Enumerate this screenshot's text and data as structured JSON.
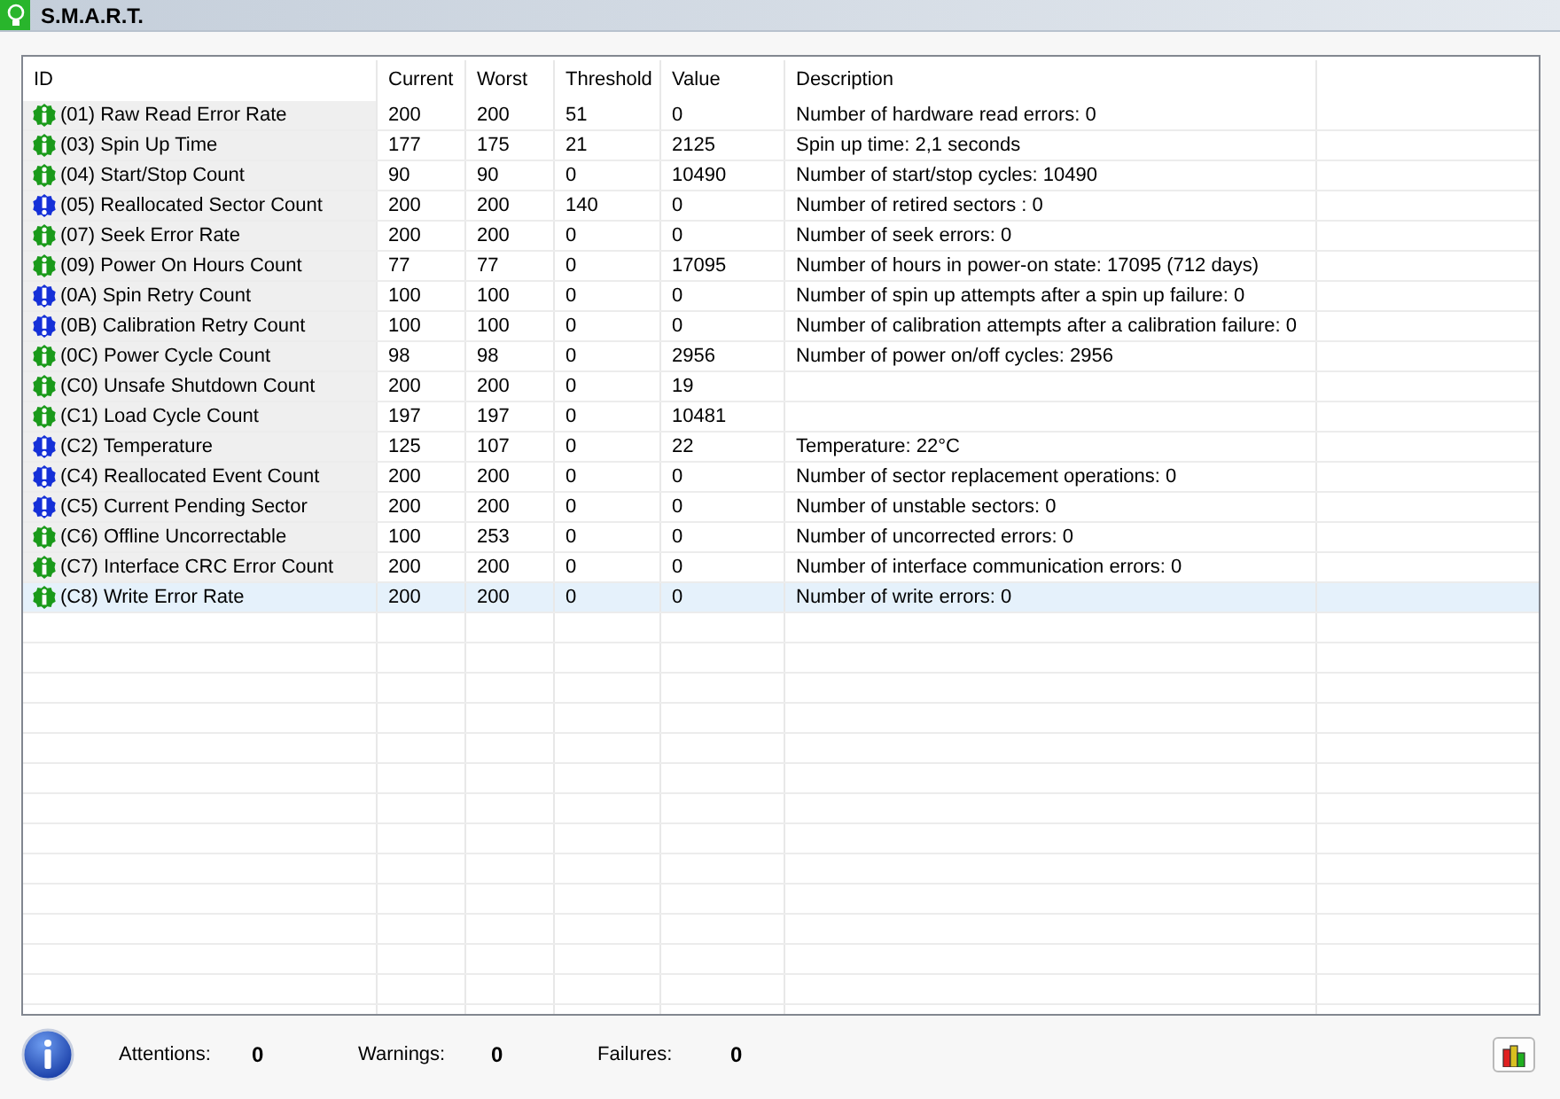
{
  "window": {
    "title": "S.M.A.R.T."
  },
  "table": {
    "columns": [
      "ID",
      "Current",
      "Worst",
      "Threshold",
      "Value",
      "Description"
    ],
    "rows": [
      {
        "kind": "ok",
        "id": "(01) Raw Read Error Rate",
        "current": "200",
        "worst": "200",
        "threshold": "51",
        "value": "0",
        "description": "Number of hardware read errors: 0",
        "selected": false
      },
      {
        "kind": "ok",
        "id": "(03) Spin Up Time",
        "current": "177",
        "worst": "175",
        "threshold": "21",
        "value": "2125",
        "description": "Spin up time: 2,1 seconds",
        "selected": false
      },
      {
        "kind": "ok",
        "id": "(04) Start/Stop Count",
        "current": "90",
        "worst": "90",
        "threshold": "0",
        "value": "10490",
        "description": "Number of start/stop cycles: 10490",
        "selected": false
      },
      {
        "kind": "critical",
        "id": "(05) Reallocated Sector Count",
        "current": "200",
        "worst": "200",
        "threshold": "140",
        "value": "0",
        "description": "Number of retired sectors : 0",
        "selected": false
      },
      {
        "kind": "ok",
        "id": "(07) Seek Error Rate",
        "current": "200",
        "worst": "200",
        "threshold": "0",
        "value": "0",
        "description": "Number of seek errors: 0",
        "selected": false
      },
      {
        "kind": "ok",
        "id": "(09) Power On Hours Count",
        "current": "77",
        "worst": "77",
        "threshold": "0",
        "value": "17095",
        "description": "Number of hours in power-on state: 17095 (712 days)",
        "selected": false
      },
      {
        "kind": "critical",
        "id": "(0A) Spin Retry Count",
        "current": "100",
        "worst": "100",
        "threshold": "0",
        "value": "0",
        "description": "Number of spin up attempts after a spin up failure: 0",
        "selected": false
      },
      {
        "kind": "critical",
        "id": "(0B) Calibration Retry Count",
        "current": "100",
        "worst": "100",
        "threshold": "0",
        "value": "0",
        "description": "Number of calibration attempts after a calibration failure: 0",
        "selected": false
      },
      {
        "kind": "ok",
        "id": "(0C) Power Cycle Count",
        "current": "98",
        "worst": "98",
        "threshold": "0",
        "value": "2956",
        "description": "Number of power on/off cycles: 2956",
        "selected": false
      },
      {
        "kind": "ok",
        "id": "(C0) Unsafe Shutdown Count",
        "current": "200",
        "worst": "200",
        "threshold": "0",
        "value": "19",
        "selected": false
      },
      {
        "kind": "ok",
        "id": "(C1) Load Cycle Count",
        "current": "197",
        "worst": "197",
        "threshold": "0",
        "value": "10481",
        "selected": false
      },
      {
        "kind": "critical",
        "id": "(C2) Temperature",
        "current": "125",
        "worst": "107",
        "threshold": "0",
        "value": "22",
        "description": "Temperature: 22°C",
        "selected": false
      },
      {
        "kind": "critical",
        "id": "(C4) Reallocated Event Count",
        "current": "200",
        "worst": "200",
        "threshold": "0",
        "value": "0",
        "description": "Number of sector replacement operations: 0",
        "selected": false
      },
      {
        "kind": "critical",
        "id": "(C5) Current Pending Sector",
        "current": "200",
        "worst": "200",
        "threshold": "0",
        "value": "0",
        "description": "Number of unstable sectors: 0",
        "selected": false
      },
      {
        "kind": "ok",
        "id": "(C6) Offline Uncorrectable",
        "current": "100",
        "worst": "253",
        "threshold": "0",
        "value": "0",
        "description": "Number of uncorrected errors: 0",
        "selected": false
      },
      {
        "kind": "ok",
        "id": "(C7) Interface CRC Error Count",
        "current": "200",
        "worst": "200",
        "threshold": "0",
        "value": "0",
        "description": "Number of interface communication errors: 0",
        "selected": false
      },
      {
        "kind": "ok",
        "id": "(C8) Write Error Rate",
        "current": "200",
        "worst": "200",
        "threshold": "0",
        "value": "0",
        "description": "Number of write errors: 0",
        "selected": true
      }
    ]
  },
  "status_bar": {
    "counters": [
      {
        "label": "Attentions:",
        "count": "0"
      },
      {
        "label": "Warnings:",
        "count": "0"
      },
      {
        "label": "Failures:",
        "count": "0"
      }
    ]
  }
}
